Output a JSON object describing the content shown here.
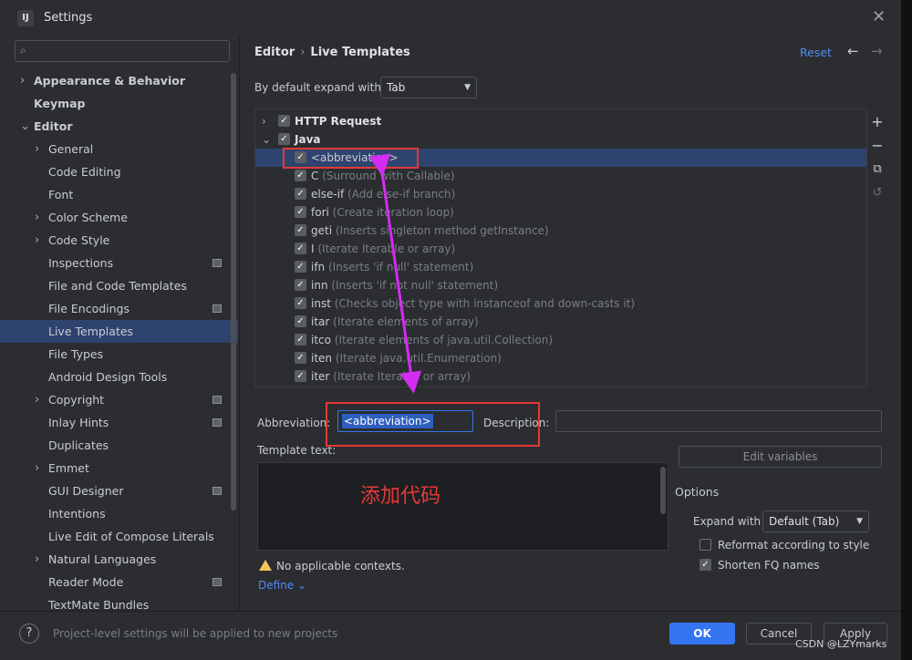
{
  "window": {
    "title": "Settings",
    "app_icon": "IJ"
  },
  "sidebar": {
    "items": [
      {
        "label": "Appearance & Behavior",
        "level": 0,
        "arrow": "›",
        "bold": true
      },
      {
        "label": "Keymap",
        "level": 0,
        "arrow": "",
        "bold": true
      },
      {
        "label": "Editor",
        "level": 0,
        "arrow": "⌄",
        "bold": true
      },
      {
        "label": "General",
        "level": 1,
        "arrow": "›"
      },
      {
        "label": "Code Editing",
        "level": 1,
        "arrow": ""
      },
      {
        "label": "Font",
        "level": 1,
        "arrow": ""
      },
      {
        "label": "Color Scheme",
        "level": 1,
        "arrow": "›"
      },
      {
        "label": "Code Style",
        "level": 1,
        "arrow": "›"
      },
      {
        "label": "Inspections",
        "level": 1,
        "arrow": "",
        "project": true
      },
      {
        "label": "File and Code Templates",
        "level": 1,
        "arrow": ""
      },
      {
        "label": "File Encodings",
        "level": 1,
        "arrow": "",
        "project": true
      },
      {
        "label": "Live Templates",
        "level": 1,
        "arrow": "",
        "selected": true
      },
      {
        "label": "File Types",
        "level": 1,
        "arrow": ""
      },
      {
        "label": "Android Design Tools",
        "level": 1,
        "arrow": ""
      },
      {
        "label": "Copyright",
        "level": 1,
        "arrow": "›",
        "project": true
      },
      {
        "label": "Inlay Hints",
        "level": 1,
        "arrow": "",
        "project": true
      },
      {
        "label": "Duplicates",
        "level": 1,
        "arrow": ""
      },
      {
        "label": "Emmet",
        "level": 1,
        "arrow": "›"
      },
      {
        "label": "GUI Designer",
        "level": 1,
        "arrow": "",
        "project": true
      },
      {
        "label": "Intentions",
        "level": 1,
        "arrow": ""
      },
      {
        "label": "Live Edit of Compose Literals",
        "level": 1,
        "arrow": ""
      },
      {
        "label": "Natural Languages",
        "level": 1,
        "arrow": "›"
      },
      {
        "label": "Reader Mode",
        "level": 1,
        "arrow": "",
        "project": true
      },
      {
        "label": "TextMate Bundles",
        "level": 1,
        "arrow": ""
      }
    ]
  },
  "header": {
    "breadcrumb_parent": "Editor",
    "breadcrumb_sep": "›",
    "breadcrumb_current": "Live Templates",
    "reset_label": "Reset",
    "back_arrow": "←",
    "fwd_arrow": "→"
  },
  "expand": {
    "label": "By default expand with",
    "value": "Tab"
  },
  "templates": [
    {
      "type": "group",
      "arrow": "›",
      "name": "HTTP Request"
    },
    {
      "type": "group",
      "arrow": "⌄",
      "name": "Java"
    },
    {
      "type": "item",
      "name": "<abbreviation>",
      "desc": "",
      "selected": true
    },
    {
      "type": "item",
      "name": "C",
      "desc": "(Surround with Callable)"
    },
    {
      "type": "item",
      "name": "else-if",
      "desc": "(Add else-if branch)"
    },
    {
      "type": "item",
      "name": "fori",
      "desc": "(Create iteration loop)"
    },
    {
      "type": "item",
      "name": "geti",
      "desc": "(Inserts singleton method getInstance)"
    },
    {
      "type": "item",
      "name": "I",
      "desc": "(Iterate Iterable or array)"
    },
    {
      "type": "item",
      "name": "ifn",
      "desc": "(Inserts 'if null' statement)"
    },
    {
      "type": "item",
      "name": "inn",
      "desc": "(Inserts 'if not null' statement)"
    },
    {
      "type": "item",
      "name": "inst",
      "desc": "(Checks object type with instanceof and down-casts it)"
    },
    {
      "type": "item",
      "name": "itar",
      "desc": "(Iterate elements of array)"
    },
    {
      "type": "item",
      "name": "itco",
      "desc": "(Iterate elements of java.util.Collection)"
    },
    {
      "type": "item",
      "name": "iten",
      "desc": "(Iterate java.util.Enumeration)"
    },
    {
      "type": "item",
      "name": "iter",
      "desc": "(Iterate Iterable or array)"
    }
  ],
  "tools": {
    "add": "+",
    "remove": "−",
    "copy": "⧉",
    "restore": "↺"
  },
  "editor": {
    "abbreviation_label": "Abbreviation:",
    "abbreviation_value": "<abbreviation>",
    "description_label": "Description:",
    "description_value": "",
    "template_text_label": "Template text:",
    "edit_variables_label": "Edit variables",
    "annotation": "添加代码",
    "warning_text": "No applicable contexts.",
    "define_label": "Define ⌄"
  },
  "options": {
    "title": "Options",
    "expand_with_label": "Expand with",
    "expand_with_value": "Default (Tab)",
    "reformat_label": "Reformat according to style",
    "reformat_checked": false,
    "shorten_label": "Shorten FQ names",
    "shorten_checked": true
  },
  "footer": {
    "help": "?",
    "note": "Project-level settings will be applied to new projects",
    "ok_label": "OK",
    "cancel_label": "Cancel",
    "apply_label": "Apply"
  },
  "watermark": "CSDN @LZYmarks",
  "colors": {
    "accent": "#3574f0",
    "selection": "#2e436e",
    "annotation": "#e53935",
    "arrow": "#d42cf2"
  }
}
